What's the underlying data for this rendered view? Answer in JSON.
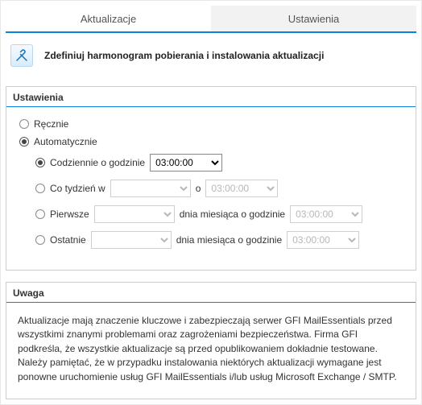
{
  "tabs": {
    "active": "Aktualizacje",
    "inactive": "Ustawienia"
  },
  "header": {
    "icon": "tools-icon",
    "text": "Zdefiniuj harmonogram pobierania i instalowania aktualizacji"
  },
  "settings_panel": {
    "title": "Ustawienia",
    "manual": {
      "label": "Ręcznie",
      "selected": false
    },
    "automatic": {
      "label": "Automatycznie",
      "selected": true
    },
    "schedule": {
      "daily": {
        "label": "Codziennie o godzinie",
        "selected": true,
        "time": "03:00:00",
        "enabled": true
      },
      "weekly": {
        "label": "Co tydzień w",
        "selected": false,
        "day": "",
        "mid": "o",
        "time": "03:00:00",
        "enabled": false
      },
      "first": {
        "label": "Pierwsze",
        "selected": false,
        "day": "",
        "mid": "dnia miesiąca o godzinie",
        "time": "03:00:00",
        "enabled": false
      },
      "last": {
        "label": "Ostatnie",
        "selected": false,
        "day": "",
        "mid": "dnia miesiąca o godzinie",
        "time": "03:00:00",
        "enabled": false
      }
    }
  },
  "note_panel": {
    "title": "Uwaga",
    "body": "Aktualizacje mają znaczenie kluczowe i zabezpieczają serwer GFI MailEssentials przed wszystkimi znanymi problemami oraz zagrożeniami bezpieczeństwa. Firma GFI podkreśla, że wszystkie aktualizacje są przed opublikowaniem dokładnie testowane. Należy pamiętać, że w przypadku instalowania niektórych aktualizacji wymagane jest ponowne uruchomienie usług GFI MailEssentials i/lub usług Microsoft Exchange / SMTP."
  }
}
